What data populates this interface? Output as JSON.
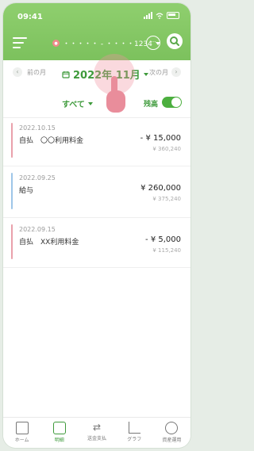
{
  "status_bar": {
    "time": "09:41"
  },
  "header": {
    "account_label": "・・・・・ - ・・・・1234"
  },
  "month_nav": {
    "prev_label": "前の月",
    "current_month": "2022年 11月",
    "next_label": "次の月"
  },
  "filters": {
    "all_label": "すべて",
    "balance_label": "残高",
    "balance_toggle_on": true
  },
  "transactions": [
    {
      "date": "2022.10.15",
      "description": "自払　〇〇利用料金",
      "amount": "- ¥ 15,000",
      "balance": "¥ 360,240",
      "accent_color": "#e9a1ab"
    },
    {
      "date": "2022.09.25",
      "description": "給与",
      "amount": "¥ 260,000",
      "balance": "¥ 375,240",
      "accent_color": "#9ec6e8"
    },
    {
      "date": "2022.09.15",
      "description": "自払　XX利用料金",
      "amount": "- ¥ 5,000",
      "balance": "¥ 115,240",
      "accent_color": "#e9a1ab"
    }
  ],
  "bottom_nav": [
    {
      "label": "ホーム",
      "icon": "home-icon",
      "active": false
    },
    {
      "label": "明細",
      "icon": "statement-icon",
      "active": true
    },
    {
      "label": "送金支払",
      "icon": "transfer-icon",
      "active": false
    },
    {
      "label": "グラフ",
      "icon": "graph-icon",
      "active": false
    },
    {
      "label": "資産運用",
      "icon": "coins-icon",
      "active": false
    }
  ],
  "colors": {
    "header_green": "#7cc15d",
    "accent_green": "#3e9a3b",
    "debit_bar": "#e9a1ab",
    "credit_bar": "#9ec6e8"
  }
}
